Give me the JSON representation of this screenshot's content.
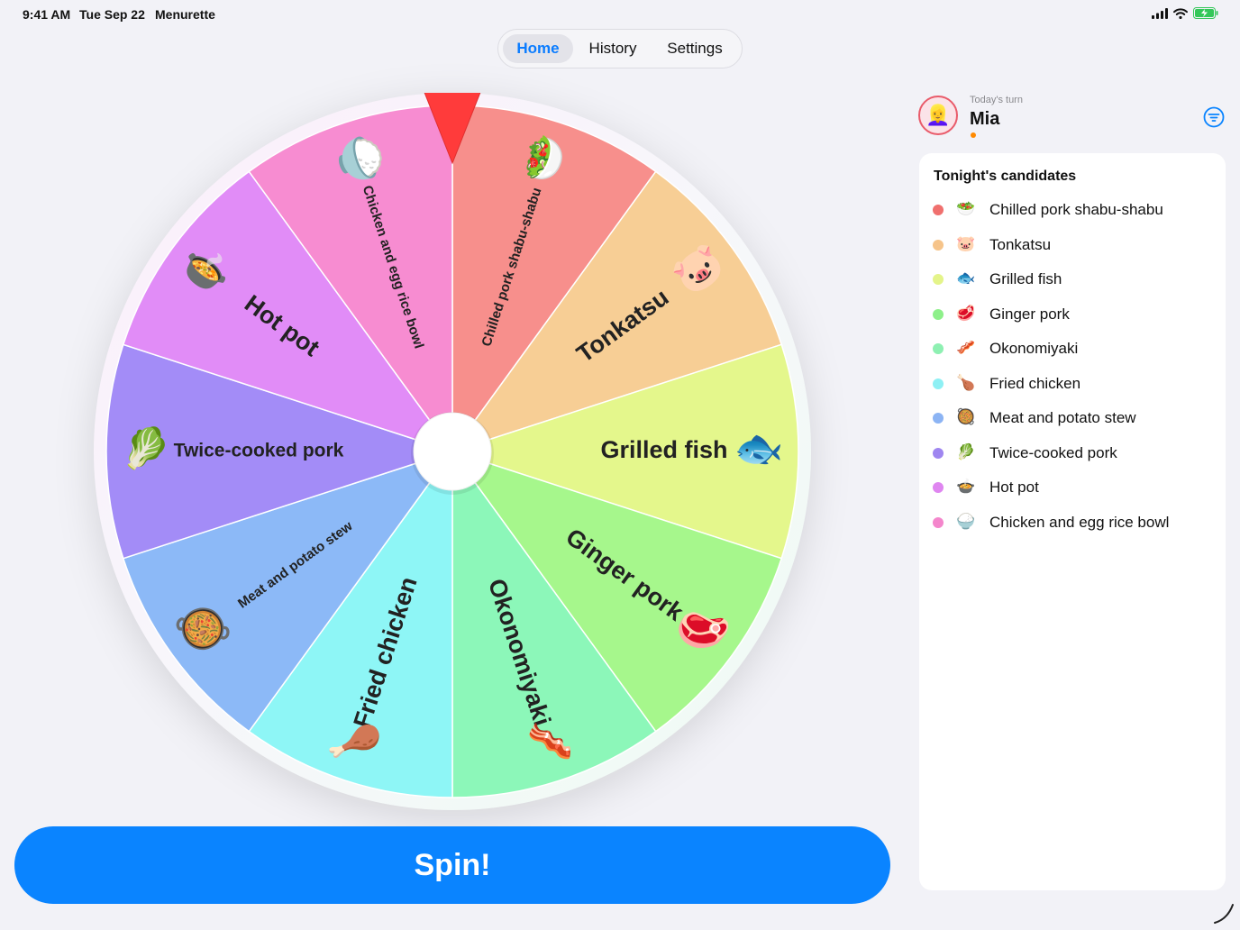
{
  "status_bar": {
    "time": "9:41 AM",
    "date": "Tue Sep 22",
    "app_name": "Menurette",
    "icons": [
      "signal-icon",
      "wifi-icon",
      "battery-charging-icon"
    ]
  },
  "tabs": [
    {
      "label": "Home",
      "active": true
    },
    {
      "label": "History",
      "active": false
    },
    {
      "label": "Settings",
      "active": false
    }
  ],
  "wheel": {
    "pointer_color": "#ff3b3b",
    "segments": [
      {
        "label": "Chilled pork shabu-shabu",
        "emoji": "🥗",
        "color": "#f78f8c",
        "size": "small"
      },
      {
        "label": "Tonkatsu",
        "emoji": "🐷",
        "color": "#f7ce95",
        "size": "large"
      },
      {
        "label": "Grilled fish",
        "emoji": "🐟",
        "color": "#e4f78c",
        "size": "large"
      },
      {
        "label": "Ginger pork",
        "emoji": "🥩",
        "color": "#a6f78c",
        "size": "large"
      },
      {
        "label": "Okonomiyaki",
        "emoji": "🥓",
        "color": "#8cf7b9",
        "size": "large"
      },
      {
        "label": "Fried chicken",
        "emoji": "🍗",
        "color": "#8ef6f6",
        "size": "large"
      },
      {
        "label": "Meat and potato stew",
        "emoji": "🥘",
        "color": "#8cb9f7",
        "size": "small"
      },
      {
        "label": "Twice-cooked pork",
        "emoji": "🥬",
        "color": "#a38cf7",
        "size": "medium"
      },
      {
        "label": "Hot pot",
        "emoji": "🍲",
        "color": "#e18cf7",
        "size": "large"
      },
      {
        "label": "Chicken and egg rice bowl",
        "emoji": "🍚",
        "color": "#f78cd1",
        "size": "small"
      }
    ]
  },
  "spin_button": {
    "label": "Spin!"
  },
  "turn": {
    "label": "Today's turn",
    "name": "Mia",
    "avatar": "👱‍♀️"
  },
  "panel": {
    "title": "Tonight's candidates",
    "items": [
      {
        "label": "Chilled pork shabu-shabu",
        "emoji": "🥗",
        "color": "#f0706e"
      },
      {
        "label": "Tonkatsu",
        "emoji": "🐷",
        "color": "#f6c48a"
      },
      {
        "label": "Grilled fish",
        "emoji": "🐟",
        "color": "#e4f48a"
      },
      {
        "label": "Ginger pork",
        "emoji": "🥩",
        "color": "#8ef08a"
      },
      {
        "label": "Okonomiyaki",
        "emoji": "🥓",
        "color": "#8ef0b2"
      },
      {
        "label": "Fried chicken",
        "emoji": "🍗",
        "color": "#8ef0f4"
      },
      {
        "label": "Meat and potato stew",
        "emoji": "🥘",
        "color": "#8cb4f4"
      },
      {
        "label": "Twice-cooked pork",
        "emoji": "🥬",
        "color": "#9f86f0"
      },
      {
        "label": "Hot pot",
        "emoji": "🍲",
        "color": "#df86f0"
      },
      {
        "label": "Chicken and egg rice bowl",
        "emoji": "🍚",
        "color": "#f486cc"
      }
    ]
  },
  "colors": {
    "accent": "#0a84ff",
    "background": "#f2f2f7"
  }
}
